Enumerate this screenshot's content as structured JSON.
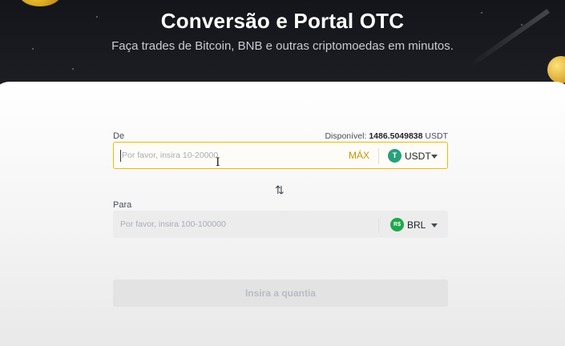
{
  "hero": {
    "title": "Conversão e Portal OTC",
    "subtitle": "Faça trades de Bitcoin, BNB e outras criptomoedas em minutos."
  },
  "form": {
    "from": {
      "label": "De",
      "available_label": "Disponível:",
      "available_value": "1486.5049838",
      "available_currency": "USDT",
      "placeholder": "Por favor, insira 10-20000",
      "max_label": "MÁX",
      "currency": "USDT",
      "currency_icon_text": "T",
      "currency_icon_color": "#26a17b"
    },
    "swap_icon": "swap-arrows-icon",
    "swap_glyph": "⇅",
    "to": {
      "label": "Para",
      "placeholder": "Por favor, insira 100-100000",
      "currency": "BRL",
      "currency_icon_text": "R$",
      "currency_icon_color": "#1ea84b"
    },
    "submit_label": "Insira a quantia"
  },
  "colors": {
    "accent": "#f0b90b",
    "max_text": "#c99400",
    "hero_bg": "#181a20"
  }
}
